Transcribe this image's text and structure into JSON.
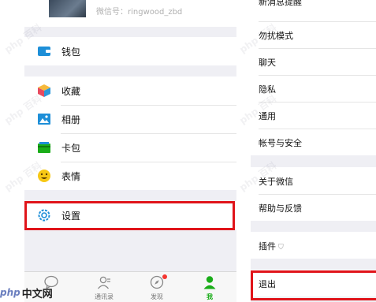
{
  "left": {
    "profile": {
      "wechat_id": "微信号：ringwood_zbd"
    },
    "wallet": {
      "label": "钱包"
    },
    "menu": [
      {
        "label": "收藏"
      },
      {
        "label": "相册"
      },
      {
        "label": "卡包"
      },
      {
        "label": "表情"
      }
    ],
    "settings": {
      "label": "设置"
    },
    "tabbar": [
      {
        "label": "",
        "icon": "chat-bubble-icon"
      },
      {
        "label": "通讯录",
        "icon": "contacts-icon"
      },
      {
        "label": "发现",
        "icon": "compass-icon"
      },
      {
        "label": "我",
        "icon": "person-icon",
        "active": true
      }
    ]
  },
  "right": {
    "top_partial": "新消息提醒",
    "group1": [
      {
        "label": "勿扰模式"
      },
      {
        "label": "聊天"
      },
      {
        "label": "隐私"
      },
      {
        "label": "通用"
      },
      {
        "label": "帐号与安全"
      }
    ],
    "group2": [
      {
        "label": "关于微信"
      },
      {
        "label": "帮助与反馈"
      }
    ],
    "plugins": {
      "label": "插件"
    },
    "logout": {
      "label": "退出"
    }
  },
  "watermark": {
    "logo_php": "php",
    "logo_cn": "中文网"
  },
  "colors": {
    "accent_green": "#1aad19",
    "highlight_red": "#e0141a",
    "background": "#efeff4"
  }
}
